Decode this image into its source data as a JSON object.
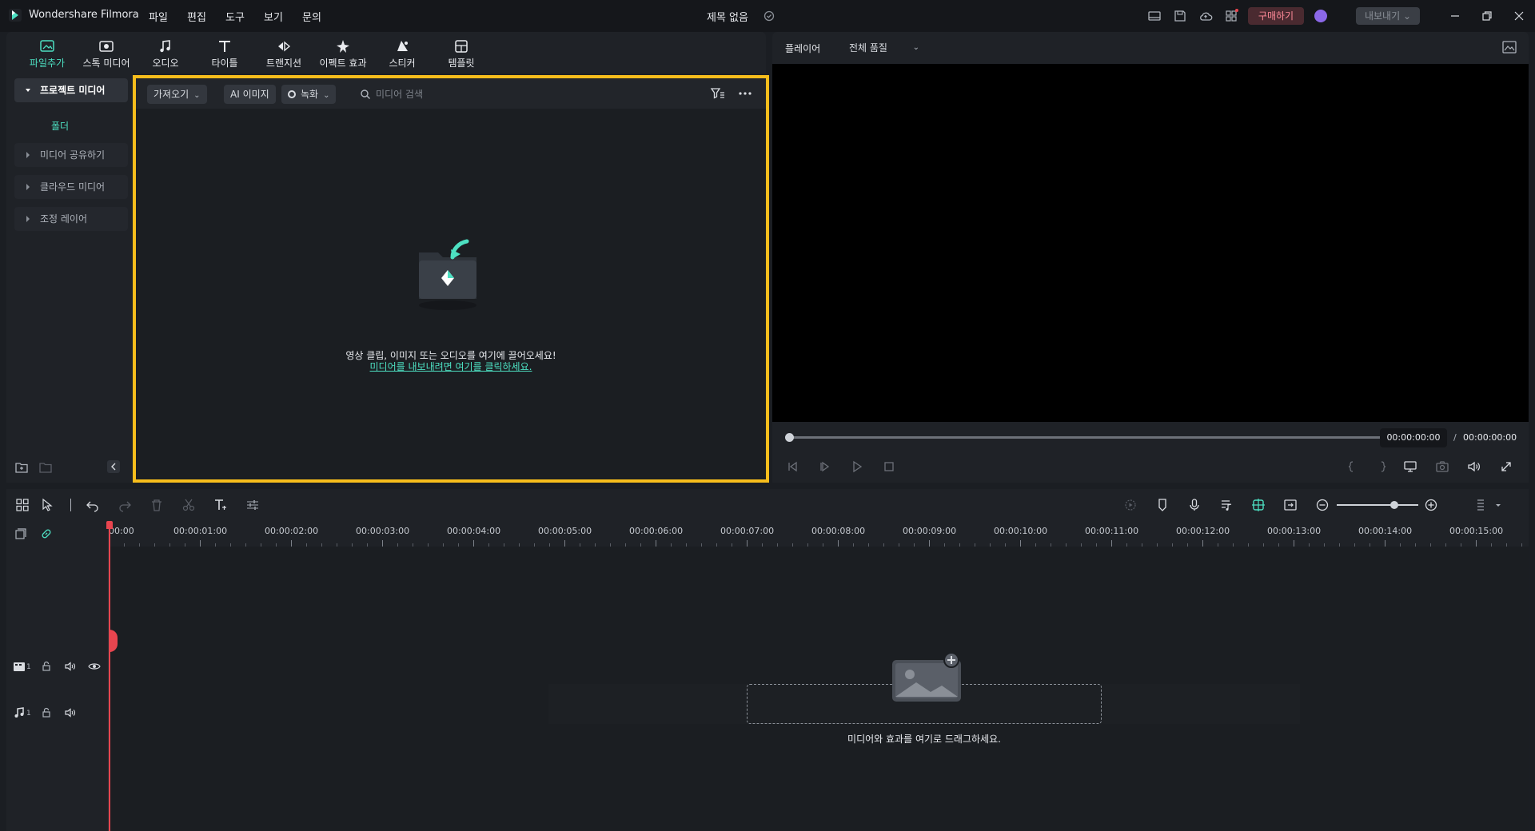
{
  "app": {
    "name": "Wondershare Filmora",
    "document_title": "제목 없음"
  },
  "menu": [
    "파일",
    "편집",
    "도구",
    "보기",
    "문의"
  ],
  "header": {
    "buy_label": "구매하기",
    "export_label": "내보내기"
  },
  "media_tabs": [
    {
      "label": "파일추가",
      "icon": "import-icon",
      "active": true
    },
    {
      "label": "스톡 미디어",
      "icon": "stock-media-icon"
    },
    {
      "label": "오디오",
      "icon": "music-note-icon"
    },
    {
      "label": "타이틀",
      "icon": "text-t-icon"
    },
    {
      "label": "트랜지션",
      "icon": "transition-icon"
    },
    {
      "label": "이펙트 효과",
      "icon": "effects-icon"
    },
    {
      "label": "스티커",
      "icon": "sticker-icon"
    },
    {
      "label": "템플릿",
      "icon": "template-icon"
    }
  ],
  "sidebar": {
    "items": [
      {
        "label": "프로젝트 미디어",
        "active": true
      },
      {
        "label": "미디어 공유하기"
      },
      {
        "label": "클라우드 미디어"
      },
      {
        "label": "조정 레이어"
      }
    ],
    "folder_label": "폴더"
  },
  "media_panel": {
    "import_label": "가져오기",
    "ai_image_label": "AI 이미지",
    "record_label": "녹화",
    "search_placeholder": "미디어 검색",
    "empty_message": "영상 클립, 이미지 또는 오디오를 여기에 끌어오세요!",
    "empty_link": "미디어를 내보내려면 여기를 클릭하세요.",
    "highlight_color": "#f7bd1c"
  },
  "player": {
    "title": "플레이어",
    "quality": "전체 품질",
    "current_time": "00:00:00:00",
    "separator": "/",
    "total_time": "00:00:00:00"
  },
  "timeline": {
    "ruler_labels": [
      "00:00",
      "00:00:01:00",
      "00:00:02:00",
      "00:00:03:00",
      "00:00:04:00",
      "00:00:05:00",
      "00:00:06:00",
      "00:00:07:00",
      "00:00:08:00",
      "00:00:09:00",
      "00:00:10:00",
      "00:00:11:00",
      "00:00:12:00",
      "00:00:13:00",
      "00:00:14:00",
      "00:00:15:00"
    ],
    "video_track_number": "1",
    "audio_track_number": "1",
    "drop_message": "미디어와 효과를 여기로 드래그하세요."
  },
  "colors": {
    "accent": "#4de0c2",
    "playhead": "#e8454f",
    "background": "#1b1e23"
  }
}
